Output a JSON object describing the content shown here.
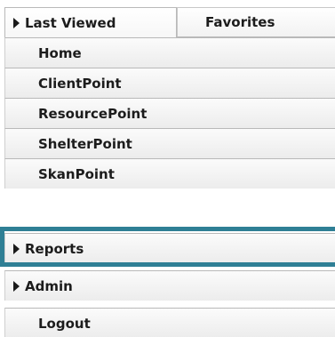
{
  "tabs": [
    {
      "label": "Last Viewed",
      "active": true,
      "icon": "expand-triangle-icon"
    },
    {
      "label": "Favorites",
      "active": false
    }
  ],
  "menu": {
    "items": [
      {
        "label": "Home"
      },
      {
        "label": "ClientPoint"
      },
      {
        "label": "ResourcePoint"
      },
      {
        "label": "ShelterPoint"
      },
      {
        "label": "SkanPoint"
      },
      {
        "label": "Reports",
        "icon": "expand-triangle-icon",
        "highlighted": true
      },
      {
        "label": "Admin",
        "icon": "expand-triangle-icon"
      },
      {
        "label": "Logout"
      }
    ]
  },
  "colors": {
    "highlight_border": "#2f7f95",
    "item_background": "#ececec",
    "divider": "#b9b9b9",
    "text": "#1c1c1c"
  }
}
